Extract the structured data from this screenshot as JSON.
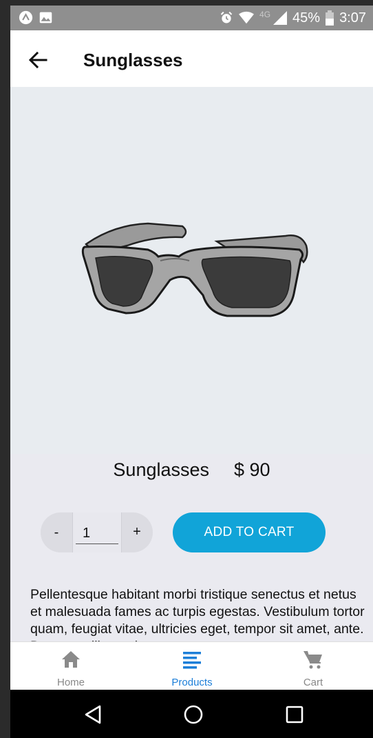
{
  "status_bar": {
    "network": "4G",
    "battery": "45%",
    "time": "3:07"
  },
  "header": {
    "title": "Sunglasses"
  },
  "product": {
    "name": "Sunglasses",
    "price": "$ 90",
    "quantity_value": "1",
    "minus_label": "-",
    "plus_label": "+",
    "add_to_cart_label": "ADD TO CART",
    "description": "Pellentesque habitant morbi tristique senectus et netus et malesuada fames ac turpis egestas. Vestibulum tortor quam, feugiat vitae, ultricies eget, tempor sit amet, ante. Donec eu libero sit amet quam egestas semper."
  },
  "bottom_nav": {
    "items": [
      {
        "label": "Home",
        "icon": "home-icon",
        "active": false
      },
      {
        "label": "Products",
        "icon": "list-icon",
        "active": true
      },
      {
        "label": "Cart",
        "icon": "cart-icon",
        "active": false
      }
    ]
  },
  "colors": {
    "accent": "#11a4d8",
    "active_nav": "#1d7fd8",
    "image_bg": "#e8ecf0",
    "content_bg": "#eaeaf0"
  }
}
